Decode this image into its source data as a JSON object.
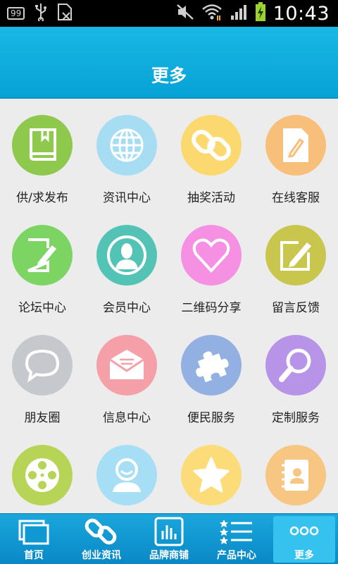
{
  "status": {
    "badge": "99",
    "time": "10:43"
  },
  "header": {
    "title": "更多"
  },
  "colors": {
    "accent": "#0aa3d8"
  },
  "grid": [
    {
      "label": "供/求发布",
      "icon": "book-icon",
      "color": "#8ec84c"
    },
    {
      "label": "资讯中心",
      "icon": "globe-icon",
      "color": "#a6ddf2"
    },
    {
      "label": "抽奖活动",
      "icon": "chain-link-icon",
      "color": "#fbd96e"
    },
    {
      "label": "在线客服",
      "icon": "document-pen-icon",
      "color": "#f8bf7a"
    },
    {
      "label": "论坛中心",
      "icon": "edit-note-icon",
      "color": "#7cd562"
    },
    {
      "label": "会员中心",
      "icon": "member-icon",
      "color": "#52c3b4"
    },
    {
      "label": "二维码分享",
      "icon": "heart-icon",
      "color": "#f590e2"
    },
    {
      "label": "留言反馈",
      "icon": "pencil-box-icon",
      "color": "#c9c64e"
    },
    {
      "label": "朋友圈",
      "icon": "chat-bubble-icon",
      "color": "#c5c9cd"
    },
    {
      "label": "信息中心",
      "icon": "envelope-icon",
      "color": "#f5a0a8"
    },
    {
      "label": "便民服务",
      "icon": "puzzle-icon",
      "color": "#93b0e2"
    },
    {
      "label": "定制服务",
      "icon": "magnifier-icon",
      "color": "#b794e8"
    },
    {
      "label": "",
      "icon": "film-reel-icon",
      "color": "#b6d456"
    },
    {
      "label": "",
      "icon": "smiley-person-icon",
      "color": "#a6def5"
    },
    {
      "label": "",
      "icon": "star-icon",
      "color": "#fcdc79"
    },
    {
      "label": "",
      "icon": "contact-book-icon",
      "color": "#f8c683"
    }
  ],
  "tabs": [
    {
      "label": "首页",
      "icon": "home-windows-icon"
    },
    {
      "label": "创业资讯",
      "icon": "chain-link-icon"
    },
    {
      "label": "品牌商铺",
      "icon": "bar-chart-icon"
    },
    {
      "label": "产品中心",
      "icon": "star-list-icon"
    },
    {
      "label": "更多",
      "icon": "more-dots-icon",
      "active": true
    }
  ]
}
